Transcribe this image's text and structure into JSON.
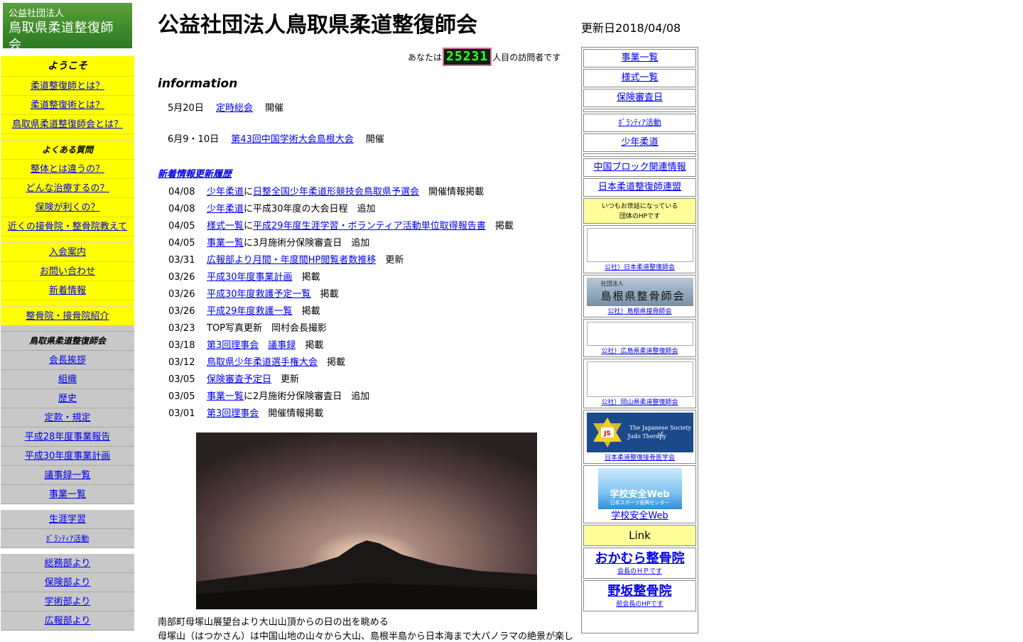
{
  "logo": {
    "line1": "公益社団法人",
    "line2": "鳥取県柔道整復師会"
  },
  "header": {
    "title": "公益社団法人鳥取県柔道整復師会",
    "updated": "更新日2018/04/08",
    "visitor_prefix": "あなたは",
    "visitor_count": "25231",
    "visitor_suffix": "人目の訪問者です"
  },
  "sidebar": {
    "welcome_heading": "ようこそ",
    "welcome": [
      "柔道整復師とは？",
      "柔道整復術とは？",
      "鳥取県柔道整復師会とは？"
    ],
    "faq_heading": "よくある質問",
    "faq": [
      "整体とは違うの？",
      "どんな治療するの？",
      "保険が利くの？",
      "近くの接骨院・整骨院教えて"
    ],
    "general": [
      "入会案内",
      "お問い合わせ",
      "新着情報"
    ],
    "clinics": "整骨院・接骨院紹介",
    "assoc_heading": "鳥取県柔道整復師会",
    "assoc": [
      "会長挨拶",
      "組織",
      "歴史",
      "定款・規定",
      "平成28年度事業報告",
      "平成30年度事業計画",
      "議事録一覧",
      "事業一覧"
    ],
    "activities": [
      "生涯学習",
      "ﾎﾞﾗﾝﾃｨｱ活動"
    ],
    "depts": [
      "総務部より",
      "保険部より",
      "学術部より",
      "広報部より"
    ]
  },
  "info": {
    "title": "information",
    "events": [
      {
        "date": "5月20日",
        "link": "定時総会",
        "suffix": "開催"
      },
      {
        "date": "6月9・10日",
        "link": "第43回中国学術大会島根大会",
        "suffix": "開催"
      }
    ]
  },
  "news": {
    "heading": "新着情報更新履歴",
    "items": [
      {
        "date": "04/08",
        "link1": "少年柔道",
        "mid": "に",
        "link2": "日整全国少年柔道形競技会鳥取県予選会",
        "tail": "開催情報掲載"
      },
      {
        "date": "04/08",
        "link1": "少年柔道",
        "mid": "に平成30年度の大会日程　追加",
        "link2": "",
        "tail": ""
      },
      {
        "date": "04/05",
        "link1": "様式一覧",
        "mid": "に",
        "link2": "平成29年度生涯学習・ボランティア活動単位取得報告書",
        "tail": "掲載"
      },
      {
        "date": "04/05",
        "link1": "事業一覧",
        "mid": "に3月施術分保険審査日　追加",
        "link2": "",
        "tail": ""
      },
      {
        "date": "03/31",
        "link1": "広報部より月間・年度間HP閲覧者数推移",
        "mid": "",
        "link2": "",
        "tail": "更新"
      },
      {
        "date": "03/26",
        "link1": "平成30年度事業計画",
        "mid": "",
        "link2": "",
        "tail": "掲載"
      },
      {
        "date": "03/26",
        "link1": "平成30年度救護予定一覧",
        "mid": "",
        "link2": "",
        "tail": "掲載"
      },
      {
        "date": "03/26",
        "link1": "平成29年度救護一覧",
        "mid": "",
        "link2": "",
        "tail": "掲載"
      },
      {
        "date": "03/23",
        "link1": "",
        "mid": "TOP写真更新　岡村会長撮影",
        "link2": "",
        "tail": ""
      },
      {
        "date": "03/18",
        "link1": "第3回理事会",
        "mid": "　",
        "link2": "議事録",
        "tail": "掲載"
      },
      {
        "date": "03/12",
        "link1": "鳥取県少年柔道選手権大会",
        "mid": "",
        "link2": "",
        "tail": "掲載"
      },
      {
        "date": "03/05",
        "link1": "保険審査予定日",
        "mid": "",
        "link2": "",
        "tail": "更新"
      },
      {
        "date": "03/05",
        "link1": "事業一覧",
        "mid": "に2月施術分保険審査日　追加",
        "link2": "",
        "tail": ""
      },
      {
        "date": "03/01",
        "link1": "第3回理事会",
        "mid": "",
        "link2": "",
        "tail": "開催情報掲載"
      }
    ]
  },
  "photo": {
    "caption1": "南部町母塚山展望台より大山山頂からの日の出を眺める",
    "caption2": "母塚山（はつかさん）は中国山地の山々から大山、島根半島から日本海まで大パノラマの絶景が楽し"
  },
  "right": {
    "links1": [
      "事業一覧",
      "様式一覧",
      "保険審査日"
    ],
    "links2": [
      "ﾎﾞﾗﾝﾃｨｱ活動",
      "少年柔道"
    ],
    "links3": [
      "中国ブロック関連情報",
      "日本柔道整復師連盟"
    ],
    "note1": "いつもお世話になっている",
    "note2": "団体のHPです",
    "banners": [
      {
        "caption": "公社）日本柔道整復師会"
      },
      {
        "caption": "公社）島根県接骨師会",
        "img_text": "島根県整骨師会",
        "img_small": "社団法人"
      },
      {
        "caption": "公社）広島県柔道整復師会"
      },
      {
        "caption": "公社）岡山県柔道整復師会"
      },
      {
        "caption": "日本柔道整復接骨医学会",
        "img_text1": "The Japanese Society of",
        "img_text2": "Judo Therapy"
      },
      {
        "caption": "学校安全Web",
        "img_text1": "学校安全Web",
        "img_text2": "日本スポーツ振興センター"
      }
    ],
    "link_heading": "Link",
    "clinics": [
      {
        "name": "おかむら整骨院",
        "sub": "会長のＨＰです"
      },
      {
        "name": "野坂整骨院",
        "sub": "前会長のHPです"
      }
    ]
  }
}
